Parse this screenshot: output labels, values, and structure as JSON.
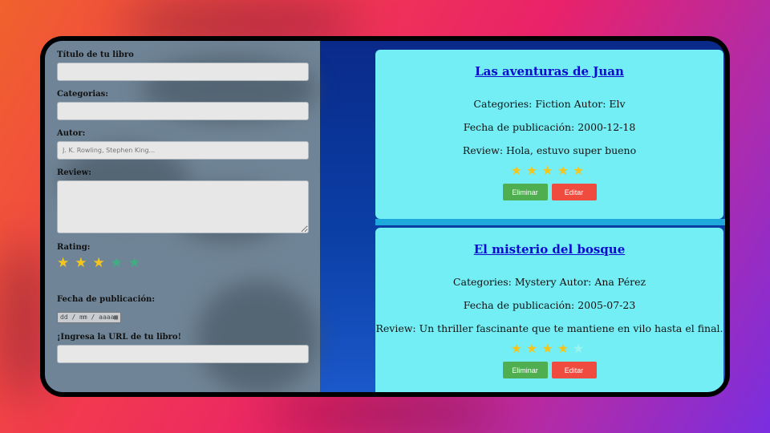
{
  "form": {
    "title_label": "Título de tu libro",
    "title_value": "",
    "categories_label": "Categorias:",
    "categories_value": "",
    "author_label": "Autor:",
    "author_placeholder": "J. K. Rowling, Stephen King...",
    "review_label": "Review:",
    "review_value": "",
    "rating_label": "Rating:",
    "rating_value": 3,
    "rating_max": 5,
    "date_label": "Fecha de publicación:",
    "date_placeholder": "dd / mm / aaaa",
    "date_icon": "calendar-icon",
    "url_label": "¡Ingresa la URL de tu libro!",
    "url_value": ""
  },
  "books": [
    {
      "title": "Las aventuras de Juan",
      "categories_line": "Categories: Fiction Autor: Elv",
      "date_line": "Fecha de publicación: 2000-12-18",
      "review_line": "Review: Hola, estuvo super bueno",
      "rating": 5,
      "delete_label": "Eliminar",
      "edit_label": "Editar"
    },
    {
      "title": "El misterio del bosque",
      "categories_line": "Categories: Mystery Autor: Ana Pérez",
      "date_line": "Fecha de publicación: 2005-07-23",
      "review_line": "Review: Un thriller fascinante que te mantiene en vilo hasta el final.",
      "rating": 4,
      "delete_label": "Eliminar",
      "edit_label": "Editar"
    }
  ],
  "colors": {
    "star_active": "#f4c51c",
    "star_inactive": "#3fae82",
    "card_bg": "#74eef5",
    "delete_button": "#4fae4f",
    "edit_button": "#ef4b3f",
    "link": "#0a0ad0"
  }
}
